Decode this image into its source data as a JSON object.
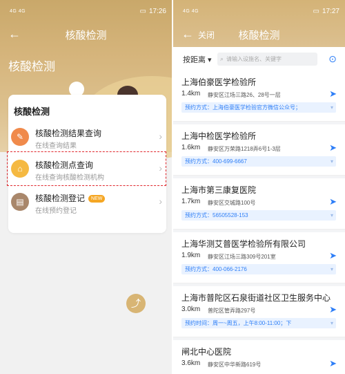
{
  "status_left": {
    "time": "17:26",
    "icons": "4G 4G"
  },
  "status_right": {
    "time": "17:27",
    "icons": "4G 4G"
  },
  "left": {
    "nav_title": "核酸检测",
    "hero_title": "核酸检测",
    "card_title": "核酸检测",
    "items": [
      {
        "label": "核酸检测结果查询",
        "sub": "在线查询结果"
      },
      {
        "label": "核酸检测点查询",
        "sub": "在线查询核酸检测机构"
      },
      {
        "label": "核酸检测登记",
        "sub": "在线预约登记",
        "badge": "NEW"
      }
    ]
  },
  "right": {
    "nav_title": "核酸检测",
    "close_label": "关闭",
    "sort_label": "按距离 ▾",
    "search_placeholder": "请输入设施名、关键字",
    "results": [
      {
        "name": "上海伯豪医学检验所",
        "dist": "1.4km",
        "addr": "静安区江场三路26、28号一层",
        "book": "预约方式：上海伯豪医学检验官方微信公众号；"
      },
      {
        "name": "上海中检医学检验所",
        "dist": "1.6km",
        "addr": "静安区万荣路1218弄6号1-3层",
        "book": "预约方式：400-699-6667"
      },
      {
        "name": "上海市第三康复医院",
        "dist": "1.7km",
        "addr": "静安区交城路100号",
        "book": "预约方式：56505528-153"
      },
      {
        "name": "上海华测艾普医学检验所有限公司",
        "dist": "1.9km",
        "addr": "静安区江场三路309号201室",
        "book": "预约方式：400-066-2176"
      },
      {
        "name": "上海市普陀区石泉街道社区卫生服务中心",
        "dist": "3.0km",
        "addr": "普陀区管弄路297号",
        "book": "预约时间：周一~周五，上午8:00-11:00；下"
      },
      {
        "name": "闸北中心医院",
        "dist": "3.6km",
        "addr": "静安区中华新路619号",
        "book": ""
      }
    ]
  },
  "colors": {
    "accent": "#2d7ef7",
    "gold": "#d4b377",
    "highlight": "#e0262b"
  }
}
